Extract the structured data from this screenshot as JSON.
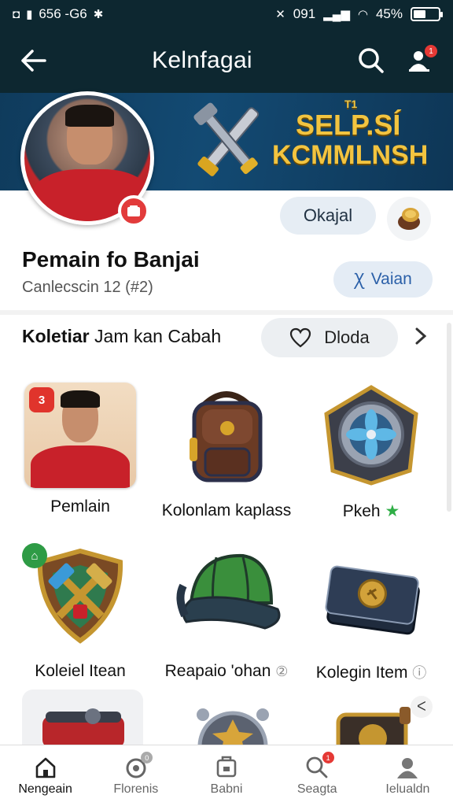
{
  "status_bar": {
    "time": "656 -G6",
    "battery": "45%",
    "battery_level": 0.45,
    "signal": "091"
  },
  "app_bar": {
    "title": "Kelnfagai",
    "notification_count": "1"
  },
  "banner": {
    "small_text": "T1",
    "line1": "SELP.SÍ",
    "line2": "KCMMLNSH"
  },
  "profile": {
    "name": "Pemain fo Banjai",
    "subtitle": "Canlecscin 12  (#2)",
    "action_primary": "Okajal",
    "action_secondary": "Vaian",
    "icon_secondary": "Ꭓ"
  },
  "filter": {
    "label_bold": "Koletiar",
    "label_rest": " Jam kan Cabah",
    "likes_label": "Dloda"
  },
  "items": [
    {
      "label": "Pemlain",
      "icon": "player-card-icon",
      "badge": "3"
    },
    {
      "label": "Kolonlam kaplass",
      "icon": "backpack-icon"
    },
    {
      "label": "Pkeh",
      "icon": "fan-emblem-icon",
      "star": "★"
    },
    {
      "label": "Koleiel Itean",
      "icon": "shield-hammer-icon",
      "badge": "⌂"
    },
    {
      "label": "Reapaio 'ohan",
      "icon": "cap-icon",
      "suffix": "②"
    },
    {
      "label": "Kolegin Item",
      "icon": "wallet-icon",
      "suffix": "ⓘ"
    }
  ],
  "bottom_nav": [
    {
      "label": "Nengeain",
      "icon": "home-icon",
      "active": true
    },
    {
      "label": "Florenis",
      "icon": "ring-icon",
      "badge": "0"
    },
    {
      "label": "Babni",
      "icon": "store-icon"
    },
    {
      "label": "Seagta",
      "icon": "search-icon",
      "badge": "1"
    },
    {
      "label": "Ielualdn",
      "icon": "profile-icon"
    }
  ],
  "colors": {
    "header_bg": "#0d2730",
    "banner_gold": "#f2c440",
    "accent_blue": "#2a5fa8",
    "alert_red": "#e53935"
  }
}
